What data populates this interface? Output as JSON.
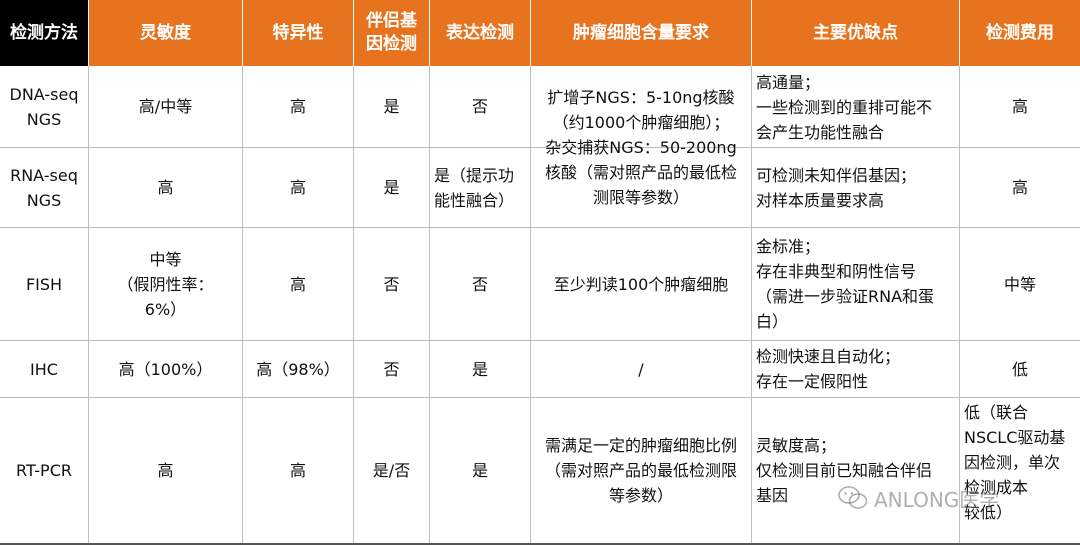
{
  "columns": [
    "检测方法",
    "灵敏度",
    "特异性",
    "伴侣基\n因检测",
    "表达检测",
    "肿瘤细胞含量要求",
    "主要优缺点",
    "检测费用"
  ],
  "rows": [
    {
      "method": "DNA-seq\nNGS",
      "sensitivity": "高/中等",
      "specificity": "高",
      "partner": "是",
      "expression": "否",
      "advantages": "高通量；\n一些检测到的重排可能不\n会产生功能性融合",
      "cost": "高"
    },
    {
      "method": "RNA-seq\nNGS",
      "sensitivity": "高",
      "specificity": "高",
      "partner": "是",
      "expression": "是（提示功\n能性融合）",
      "advantages": "可检测未知伴侣基因；\n对样本质量要求高",
      "cost": "高"
    },
    {
      "method": "FISH",
      "sensitivity": "中等\n（假阴性率：\n6%）",
      "specificity": "高",
      "partner": "否",
      "expression": "否",
      "tumor": "至少判读100个肿瘤细胞",
      "advantages": "金标准；\n存在非典型和阴性信号\n（需进一步验证RNA和蛋\n白）",
      "cost": "中等"
    },
    {
      "method": "IHC",
      "sensitivity": "高（100%）",
      "specificity": "高（98%）",
      "partner": "否",
      "expression": "是",
      "tumor": "/",
      "advantages": "检测快速且自动化；\n存在一定假阳性",
      "cost": "低"
    },
    {
      "method": "RT-PCR",
      "sensitivity": "高",
      "specificity": "高",
      "partner": "是/否",
      "expression": "是",
      "tumor": "需满足一定的肿瘤细胞比例\n（需对照产品的最低检测限\n等参数）",
      "advantages": "灵敏度高；\n仅检测目前已知融合伴侣\n基因",
      "cost": "低（联合\nNSCLC驱动基\n因检测，单次\n检测成本\n较低）"
    }
  ],
  "ngs_tumor_requirement": "扩增子NGS：5-10ng核酸\n（约1000个肿瘤细胞）；\n杂交捕获NGS：50-200ng\n核酸（需对照产品的最低检\n测限等参数）",
  "watermark": "ANLONG医学",
  "colors": {
    "header_orange": "#e8731f",
    "header_black": "#000000",
    "grid": "#bdbdbd"
  }
}
